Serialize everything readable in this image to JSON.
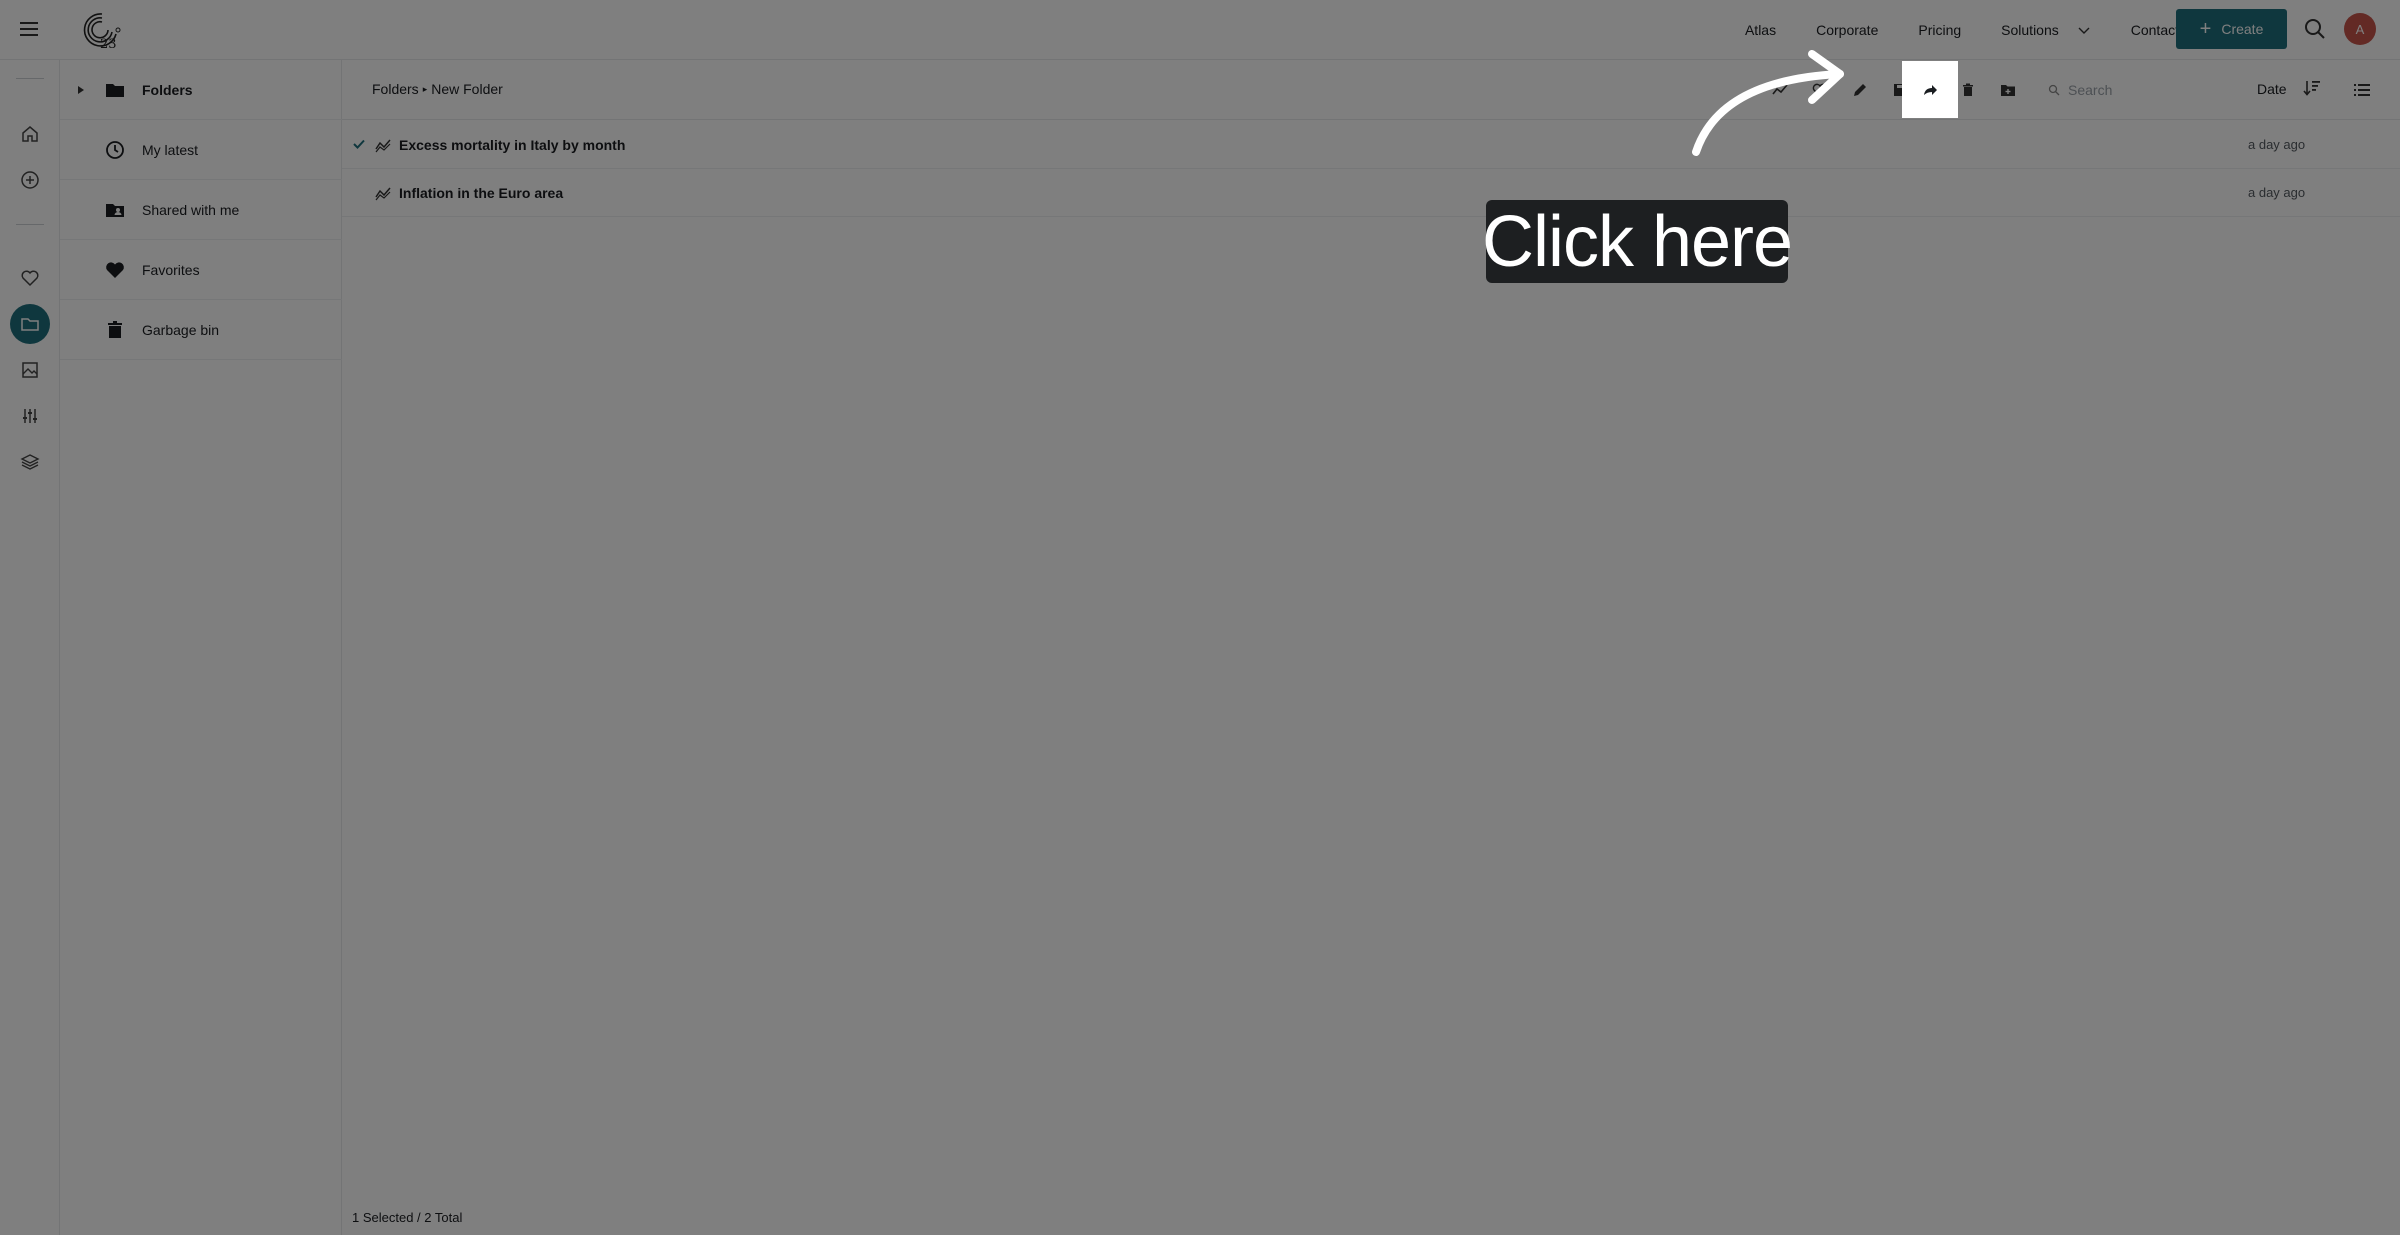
{
  "topnav": {
    "links": [
      "Atlas",
      "Corporate",
      "Pricing",
      "Solutions",
      "Contact Us"
    ],
    "create_label": "Create",
    "avatar_initial": "A"
  },
  "sidebar": {
    "items": [
      {
        "label": "Folders"
      },
      {
        "label": "My latest"
      },
      {
        "label": "Shared with me"
      },
      {
        "label": "Favorites"
      },
      {
        "label": "Garbage bin"
      }
    ]
  },
  "toolbar": {
    "breadcrumb": [
      "Folders",
      "New Folder"
    ],
    "search_placeholder": "Search",
    "sort_label": "Date"
  },
  "files": [
    {
      "title": "Excess mortality in Italy by month",
      "date": "a day ago",
      "selected": true
    },
    {
      "title": "Inflation in the Euro area",
      "date": "a day ago",
      "selected": false
    }
  ],
  "status": "1 Selected / 2 Total",
  "overlay": {
    "tooltip": "Click here"
  },
  "colors": {
    "accent": "#1e6f7c",
    "avatar": "#c7554a",
    "tooltip_bg": "#1d1f21"
  }
}
